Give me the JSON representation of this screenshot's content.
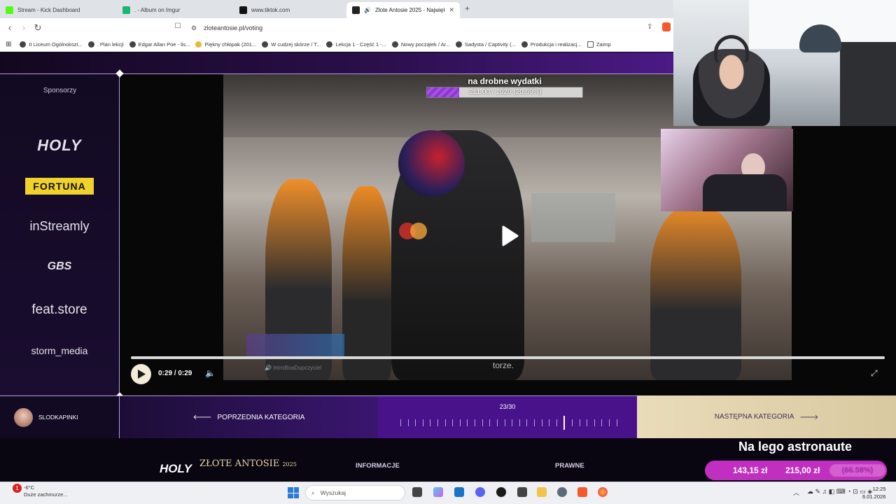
{
  "browser": {
    "tabs": [
      {
        "title": "Stream - Kick Dashboard",
        "color": "#53fc18"
      },
      {
        "title": ". - Album on Imgur",
        "color": "#1bb76e"
      },
      {
        "title": "www.tiktok.com",
        "color": "#111111"
      },
      {
        "title": "Złote Antosie 2025 - Największ",
        "color": "#222222",
        "active": true
      }
    ],
    "url": "zloteantosie.pl/voting",
    "bookmarks": [
      "II Liceum Ogólnokszt...",
      ". Plan lekcji",
      "Edgar Allan Poe - lis...",
      "Piękny chłopak (201...",
      "W cudzej skórze / T...",
      "Lekcja 1 - Część 1 -...",
      "Nowy początek / Ar...",
      "Sadysta / Captivity (...",
      "Produkcja i realizacj...",
      "Zaimp"
    ]
  },
  "sidebar": {
    "title": "Sponsorzy",
    "sponsors": [
      "HOLY",
      "FORTUNA",
      "inStreamly",
      "GBS",
      "feat.store",
      "storm_media"
    ]
  },
  "video": {
    "donation_label": "na drobne wydatki",
    "donation_value": "211.00 / 1020 (20.69%)",
    "donation_progress": 0.2069,
    "time": "0:29 / 0:29",
    "watermark": "torze.",
    "overlay_caption": "IntroBoaDupczyciel",
    "accent": "#8d38d1"
  },
  "category_nav": {
    "username": "SLODKAPINKI",
    "prev_label": "POPRZEDNIA KATEGORIA",
    "counter": "23/30",
    "current": 23,
    "total": 30,
    "next_label": "NASTĘPNA KATEGORIA"
  },
  "footer": {
    "logo_holy": "HOLY",
    "logo_zlote": "ZŁOTE ANTOSIE",
    "logo_year": "2025",
    "info_heading": "INFORMACJE",
    "legal_heading": "PRAWNE"
  },
  "goal": {
    "title": "Na lego astronaute",
    "current": "143,15 zł",
    "target": "215,00 zł",
    "percent": "(66.58%)",
    "color": "#c02fbf"
  },
  "taskbar": {
    "weather_temp": "-6°C",
    "weather_desc": "Duże zachmurze...",
    "search_placeholder": "Wyszukaj",
    "time": "12:25",
    "date": "6.01.2026",
    "notification_count": "1"
  }
}
